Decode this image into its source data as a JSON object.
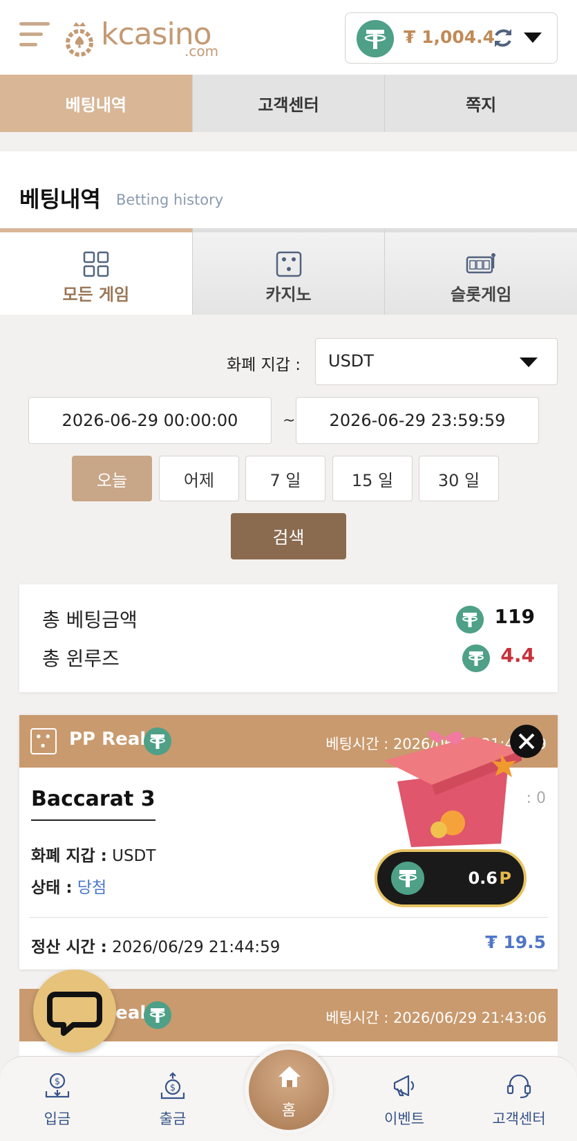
{
  "header": {
    "logo_text": "kcasino",
    "logo_sub": ".com",
    "wallet_amount": "₮ 1,004.4"
  },
  "top_tabs": [
    {
      "label": "베팅내역"
    },
    {
      "label": "고객센터"
    },
    {
      "label": "쪽지"
    }
  ],
  "page": {
    "title_ko": "베팅내역",
    "title_en": "Betting history"
  },
  "game_tabs": [
    {
      "label": "모든 게임",
      "icon": "grid-icon"
    },
    {
      "label": "카지노",
      "icon": "dice-icon"
    },
    {
      "label": "슬롯게임",
      "icon": "slot-machine-icon"
    }
  ],
  "filter": {
    "currency_label": "화폐 지갑 :",
    "currency_value": "USDT",
    "date_from": "2026-06-29 00:00:00",
    "date_to": "2026-06-29 23:59:59",
    "tilde": "~",
    "ranges": [
      "오늘",
      "어제",
      "7 일",
      "15 일",
      "30 일"
    ],
    "search_label": "검색"
  },
  "summary": {
    "total_bet_label": "총 베팅금액",
    "total_bet_value": "119",
    "total_winloss_label": "총 윈루즈",
    "total_winloss_value": "4.4"
  },
  "bet_card": {
    "provider": "PP Real",
    "bet_time": "베팅시간 : 2026/06/29 21:44:59",
    "game": "Baccarat 3",
    "extra": ": 0",
    "currency_row_label": "화폐 지갑 :",
    "currency_row_value": " USDT",
    "status_label": "상태 :",
    "status_value": " 당첨",
    "settle_label": "정산 시간 :",
    "settle_value": " 2026/06/29 21:44:59",
    "amount": "₮ 19.5"
  },
  "bet_card2": {
    "provider": "PP Real",
    "bet_time": "베팅시간 : 2026/06/29 21:43:06"
  },
  "point_popup": {
    "value": "0.6",
    "unit": "P"
  },
  "bottom_nav": [
    {
      "label": "입금",
      "icon": "deposit-icon"
    },
    {
      "label": "출금",
      "icon": "withdraw-icon"
    },
    {
      "label": "홈",
      "icon": "home-icon"
    },
    {
      "label": "이벤트",
      "icon": "megaphone-icon"
    },
    {
      "label": "고객센터",
      "icon": "headset-icon"
    }
  ],
  "colors": {
    "accent": "#d8b696",
    "tether": "#4ea087",
    "loss": "#c8313a",
    "win_link": "#4a78c8"
  }
}
